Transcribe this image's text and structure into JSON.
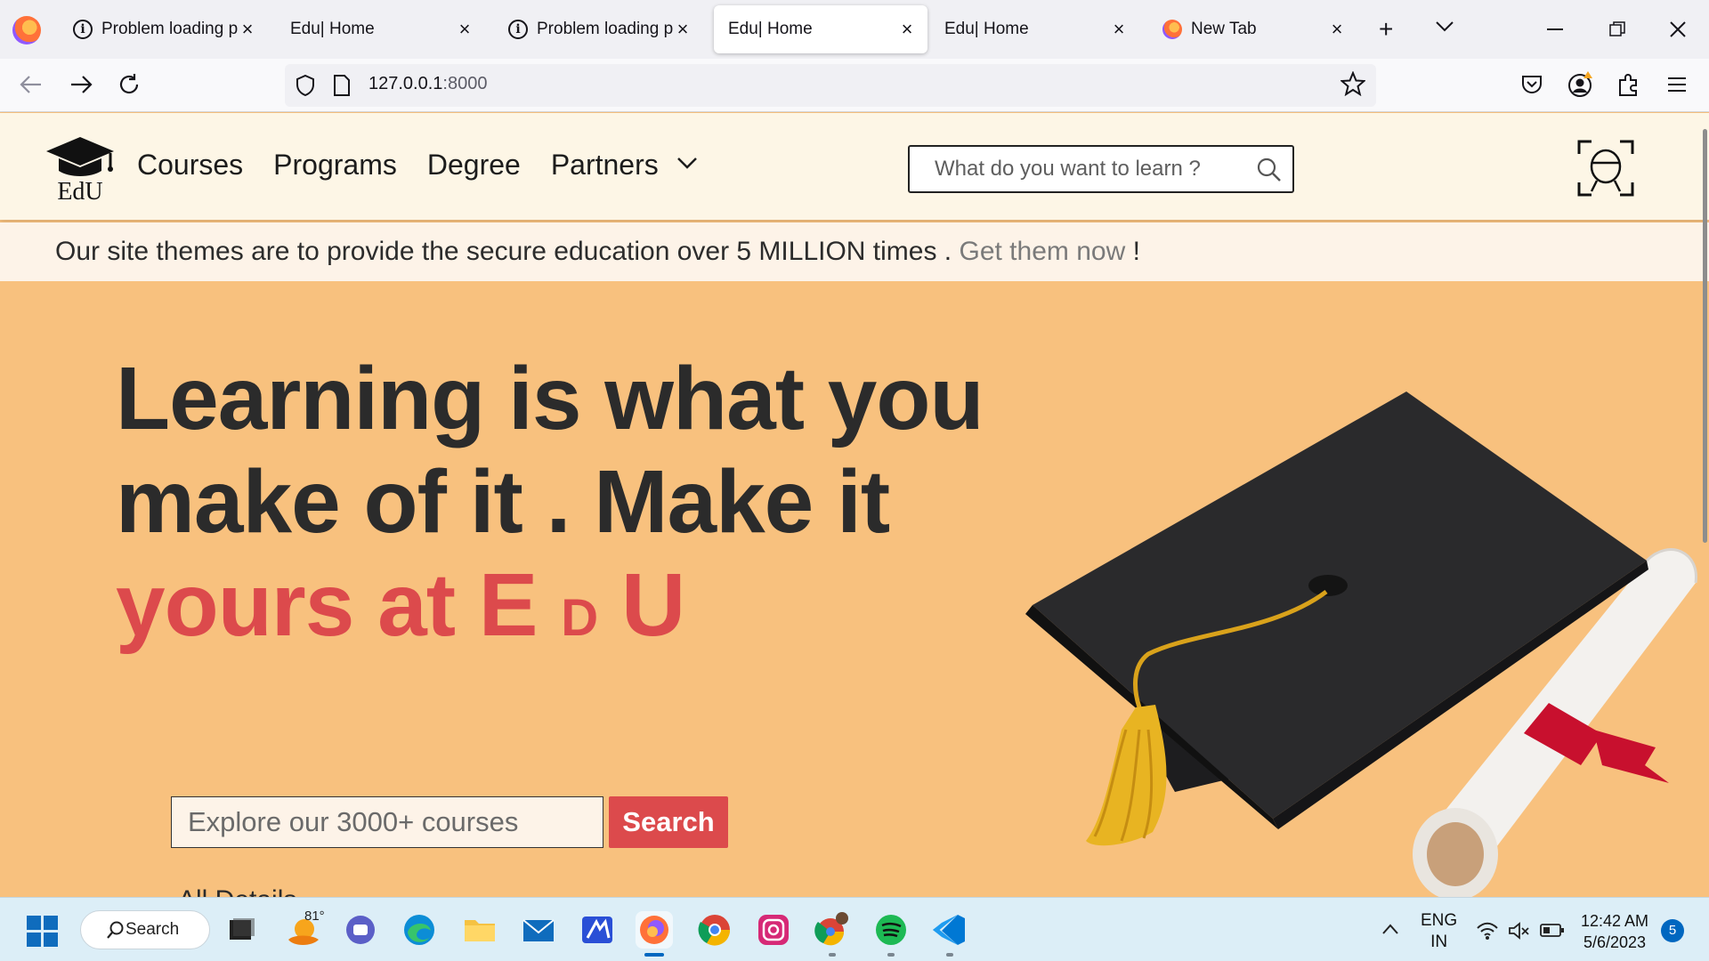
{
  "browser": {
    "tabs": [
      {
        "title": "Problem loading page",
        "icon": "info-icon",
        "active": false
      },
      {
        "title": "Edu| Home",
        "icon": "none",
        "active": false
      },
      {
        "title": "Problem loading page",
        "icon": "info-icon",
        "active": false
      },
      {
        "title": "Edu| Home",
        "icon": "none",
        "active": true
      },
      {
        "title": "Edu| Home",
        "icon": "none",
        "active": false
      },
      {
        "title": "New Tab",
        "icon": "firefox-icon",
        "active": false
      }
    ],
    "url_host": "127.0.0.1",
    "url_port": ":8000"
  },
  "site": {
    "logo_text": "EdU",
    "nav": [
      "Courses",
      "Programs",
      "Degree",
      "Partners"
    ],
    "search_placeholder": "What do you want to learn ?",
    "announcement_text": "Our site themes are to provide the secure education over 5 MILLION times . ",
    "announcement_link": "Get them now",
    "announcement_end": " !",
    "hero_line1": "Learning is what you",
    "hero_line2": "make of it . Make it",
    "hero_accent_yours": "yours at ",
    "hero_accent_e": "E",
    "hero_accent_d": "D",
    "hero_accent_u": "U",
    "hero_search_placeholder": "Explore our 3000+ courses",
    "hero_search_button": "Search",
    "all_details": "All Details"
  },
  "taskbar": {
    "search_label": "Search",
    "weather_temp": "81°",
    "lang_line1": "ENG",
    "lang_line2": "IN",
    "time": "12:42 AM",
    "date": "5/6/2023",
    "notification_count": "5"
  },
  "colors": {
    "hero_bg": "#f8c17e",
    "accent": "#dc4a4c",
    "header_bg": "#fdf6e6"
  }
}
